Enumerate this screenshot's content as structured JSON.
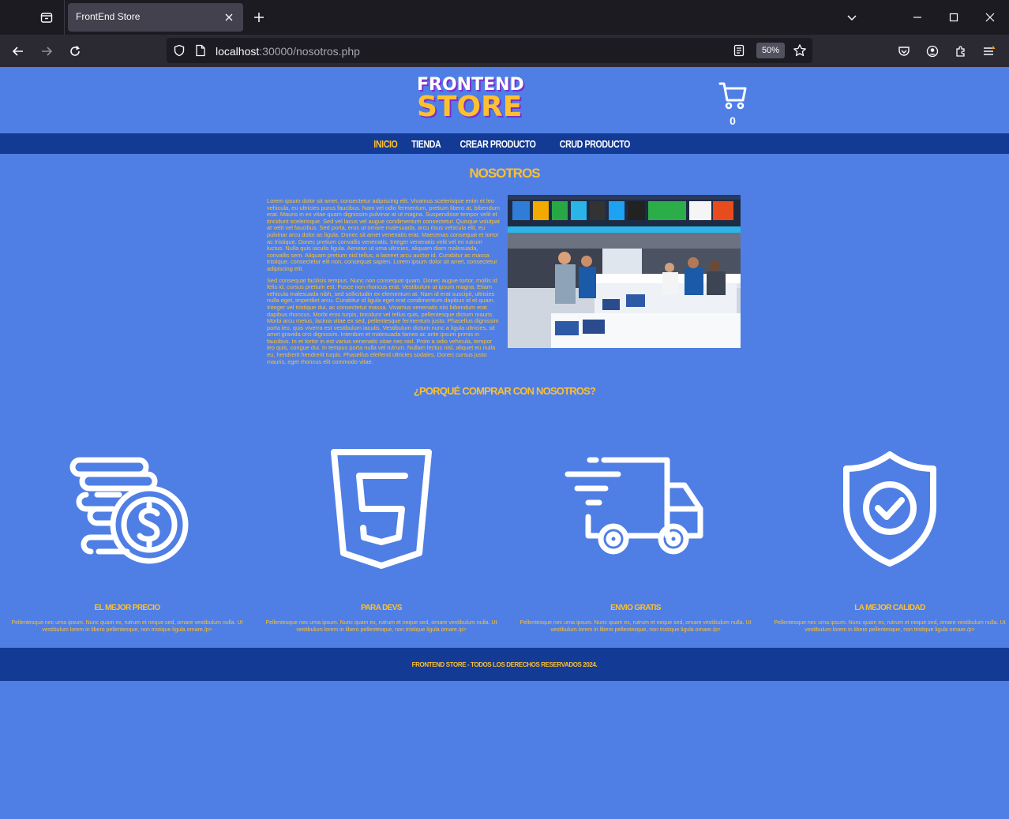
{
  "browser": {
    "tab_title": "FrontEnd Store",
    "url_host": "localhost",
    "url_rest": ":30000/nosotros.php",
    "zoom": "50%"
  },
  "header": {
    "logo_top": "FRONTEND",
    "logo_bottom": "STORE",
    "cart_count": "0"
  },
  "menu": {
    "items": [
      "INICIO",
      "TIENDA",
      "CREAR PRODUCTO",
      "CRUD PRODUCTO"
    ]
  },
  "about": {
    "title": "NOSOTROS",
    "p1": "Lorem ipsum dolor sit amet, consectetur adipiscing elit. Vivamus scelerisque enim et leo vehicula, eu ultricies purus faucibus. Nam vel odio fermentum, pretium libero at, bibendum erat. Mauris in ex vitae quam dignissim pulvinar at ut magna. Suspendisse tempor velit et tincidunt scelerisque. Sed vel lacus vel augue condimentum consectetur. Quisque volutpat at velit vel faucibus. Sed porta, eros ut ornare malesuada, arcu risus vehicula elit, eu pulvinar arcu dolor ac ligula. Donec sit amet venenatis erat. Maecenas consequat et tortor ac tristique. Donec pretium convallis venenatis. Integer venenatis velit vel mi rutrum luctus. Nulla quis iaculis ligula. Aenean ut urna ultricies, aliquam diam malesuada, convallis sem. Aliquam pretium nisl tellus, a laoreet arcu auctor id. Curabitur ac massa tristique, consectetur elit non, consequat sapien. Lorem ipsum dolor sit amet, consectetur adipiscing elit.",
    "p2": "Sed consequat facilisis tempus. Nunc non consequat quam. Donec augue tortor, mollis id felis id, cursus pretium est. Fusce non rhoncus erat. Vestibulum ut ipsum magna. Etiam vehicula malesuada nibh, sed sollicitudin ex elementum at. Nam id erat suscipit, ultricies nulla eget, imperdiet arcu. Curabitur id ligula eget erat condimentum dapibus id et quam. Integer vel tristique dui, ac consectetur massa. Vivamus venenatis nisi bibendum erat dapibus rhoncus. Morbi eros turpis, tincidunt vel tellus quis, pellentesque dictum mauris. Morbi arcu metus, lacinia vitae ex sed, pellentesque fermentum justo. Phasellus dignissim porta leo, quis viverra est vestibulum iaculis. Vestibulum dictum nunc a ligula ultricies, sit amet gravida orci dignissim. Interdum et malesuada fames ac ante ipsum primis in faucibus. In et tortor in est varius venenatis vitae nec nisl. Proin a odio vehicula, tempor leo quis, congue dui. In tempus porta nulla vel rutrum. Nullam lectus nisl, aliquet eu nulla eu, hendrerit hendrerit turpis. Phasellus eleifend ultricies sodales. Donec cursus justo mauris, eget rhoncus elit commodo vitae."
  },
  "why": {
    "title": "¿PORQUÉ COMPRAR CON NOSOTROS?",
    "features": [
      {
        "icon": "coins-dollar-icon",
        "title": "EL MEJOR PRECIO",
        "text": "Pellentesque nec urna ipsum. Nunc quam ex, rutrum et neque sed, ornare vestibulum nulla. Ut vestibulum lorem in libero pellentesque, non tristique ligula ornare./p>"
      },
      {
        "icon": "html5-icon",
        "title": "PARA DEVS",
        "text": "Pellentesque nec urna ipsum. Nunc quam ex, rutrum et neque sed, ornare vestibulum nulla. Ut vestibulum lorem in libero pellentesque, non tristique ligula ornare./p>"
      },
      {
        "icon": "delivery-truck-icon",
        "title": "ENVIO GRATIS",
        "text": "Pellentesque nec urna ipsum. Nunc quam ex, rutrum et neque sed, ornare vestibulum nulla. Ut vestibulum lorem in libero pellentesque, non tristique ligula ornare./p>"
      },
      {
        "icon": "shield-check-icon",
        "title": "LA MEJOR CALIDAD",
        "text": "Pellentesque nec urna ipsum. Nunc quam ex, rutrum et neque sed, ornare vestibulum nulla. Ut vestibulum lorem in libero pellentesque, non tristique ligula ornare./p>"
      }
    ]
  },
  "footer": {
    "text": "FRONTEND STORE - TODOS LOS DERECHOS RESERVADOS 2024."
  },
  "colors": {
    "page_bg": "#4f7fe4",
    "nav_bg": "#133a94",
    "accent": "#fdc02f"
  }
}
